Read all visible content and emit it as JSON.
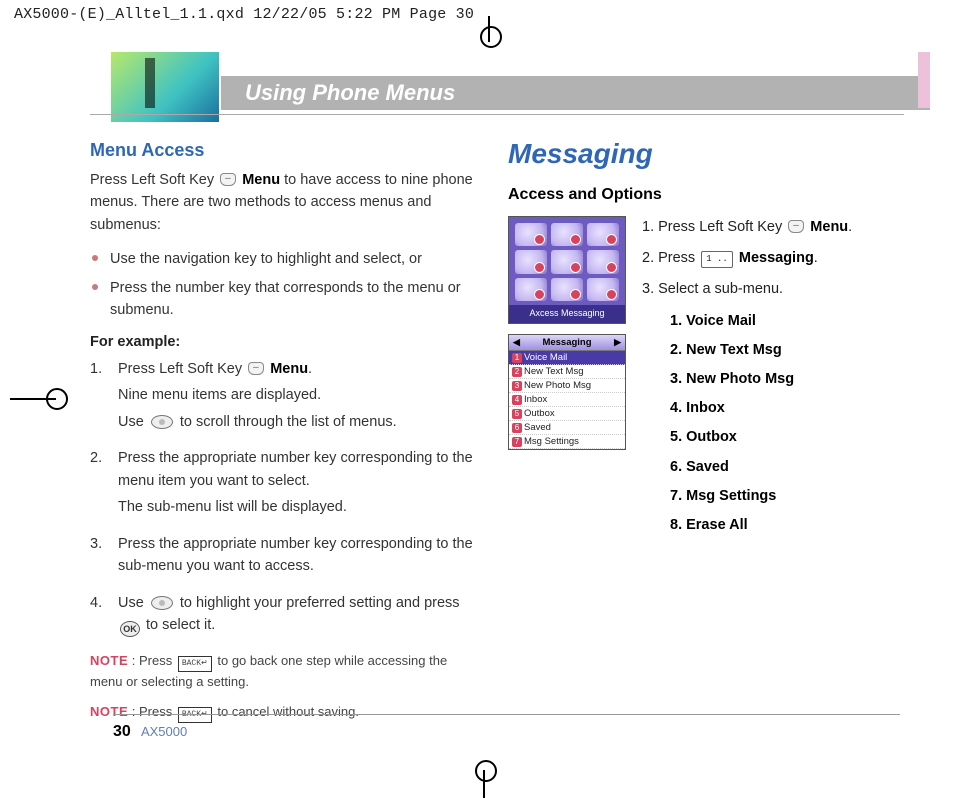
{
  "crop_header": "AX5000-(E)_Alltel_1.1.qxd  12/22/05  5:22 PM  Page 30",
  "banner": {
    "title": "Using Phone Menus"
  },
  "left": {
    "heading": "Menu Access",
    "intro_a": "Press Left Soft Key ",
    "intro_menu": "Menu",
    "intro_b": " to have access to nine phone menus. There are two methods to access menus and submenus:",
    "bullet1": "Use the navigation key to highlight and select, or",
    "bullet2": "Press the number key that corresponds to the menu or submenu.",
    "for_example": "For example:",
    "step1_a": "Press Left Soft Key ",
    "step1_menu": "Menu",
    "step1_b": ".",
    "step1_c": "Nine menu items are displayed.",
    "step1_d_a": "Use ",
    "step1_d_b": " to scroll through the list of menus.",
    "step2_a": "Press the appropriate number key corresponding to the menu item you want to select.",
    "step2_b": "The sub-menu list will be displayed.",
    "step3": "Press the appropriate number key corresponding to the sub-menu you want to access.",
    "step4_a": "Use ",
    "step4_b": " to highlight your preferred setting and press ",
    "step4_ok": "OK",
    "step4_c": " to select it.",
    "note_label": "NOTE",
    "note1_a": " : Press ",
    "note1_back": "BACK↵",
    "note1_b": " to go back one step while accessing the menu or selecting a setting.",
    "note2_a": " : Press ",
    "note2_back": "BACK↵",
    "note2_b": " to cancel without saving."
  },
  "right": {
    "heading": "Messaging",
    "subheading": "Access and Options",
    "shot1_label": "Axcess Messaging",
    "shot2_title": "Messaging",
    "shot2_items": [
      "Voice Mail",
      "New Text Msg",
      "New Photo Msg",
      "Inbox",
      "Outbox",
      "Saved",
      "Msg Settings"
    ],
    "step1_a": "1.  Press Left Soft Key ",
    "step1_menu": "Menu",
    "step1_b": ".",
    "step2_a": "2.  Press ",
    "step2_key": "1 ..",
    "step2_label": "Messaging",
    "step2_b": ".",
    "step3": "3.  Select a sub-menu.",
    "sub": [
      "1.  Voice Mail",
      "2.  New Text Msg",
      "3.  New Photo Msg",
      "4.  Inbox",
      "5.  Outbox",
      "6.  Saved",
      "7.  Msg Settings",
      "8.  Erase All"
    ]
  },
  "footer": {
    "page": "30",
    "model": "AX5000"
  }
}
